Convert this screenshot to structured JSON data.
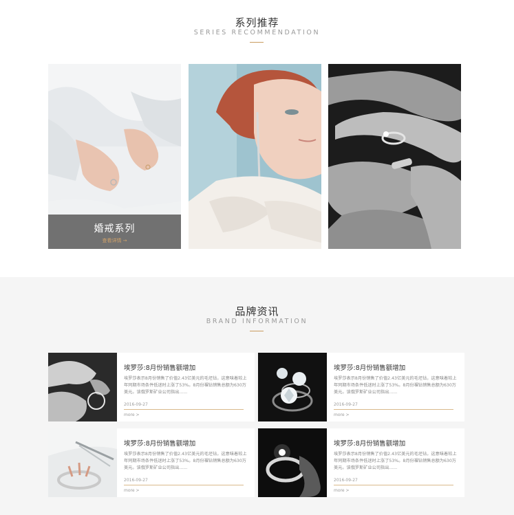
{
  "series": {
    "title": "系列推荐",
    "subtitle": "SERIES RECOMMENDATION",
    "cards": [
      {
        "label": "婚戒系列",
        "link": "查看详情  →"
      },
      {
        "label": "",
        "link": ""
      },
      {
        "label": "",
        "link": ""
      }
    ]
  },
  "brand": {
    "title": "品牌资讯",
    "subtitle": "BRAND INFORMATION",
    "items": [
      {
        "title": "埃罗莎:8月份销售额增加",
        "desc": "埃罗莎表示8月份销售了价值2.43亿美元的毛坯钻，这意味着较上年同期市场条件低迷时上涨了53%。8月份裸钻销售总额为630万美元。该俄罗斯矿业公司指出......",
        "date": "2016-09-27",
        "more": "more >"
      },
      {
        "title": "埃罗莎:8月份销售额增加",
        "desc": "埃罗莎表示8月份销售了价值2.43亿美元的毛坯钻，这意味着较上年同期市场条件低迷时上涨了53%。8月份裸钻销售总额为630万美元。该俄罗斯矿业公司指出......",
        "date": "2016-09-27",
        "more": "more >"
      },
      {
        "title": "埃罗莎:8月份销售额增加",
        "desc": "埃罗莎表示8月份销售了价值2.43亿美元的毛坯钻，这意味着较上年同期市场条件低迷时上涨了53%。8月份裸钻销售总额为630万美元。该俄罗斯矿业公司指出......",
        "date": "2016-09-27",
        "more": "more >"
      },
      {
        "title": "埃罗莎:8月份销售额增加",
        "desc": "埃罗莎表示8月份销售了价值2.43亿美元的毛坯钻，这意味着较上年同期市场条件低迷时上涨了53%。8月份裸钻销售总额为630万美元。该俄罗斯矿业公司指出......",
        "date": "2016-09-27",
        "more": "more >"
      }
    ]
  },
  "colors": {
    "accent": "#c99b5e",
    "overlay": "#5f5f5f",
    "section_bg": "#f5f5f5"
  }
}
